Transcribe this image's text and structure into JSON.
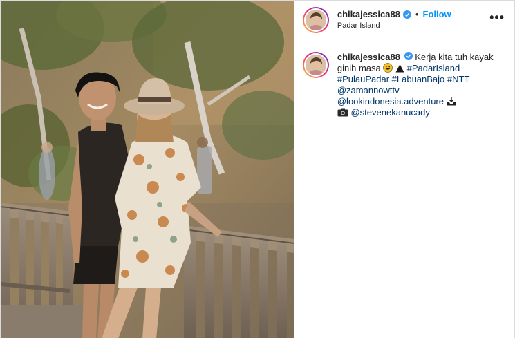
{
  "post": {
    "username": "chikajessica88",
    "verified": true,
    "follow_label": "Follow",
    "separator": "•",
    "location": "Padar Island",
    "more_label": "•••",
    "caption": {
      "username": "chikajessica88",
      "text_1": "Kerja kita tuh kayak ginih masa",
      "tags": [
        "#PadarIsland",
        "#PulauPadar",
        "#LabuanBajo",
        "#NTT"
      ],
      "mentions": [
        "@zamannowttv",
        "@lookindonesia.adventure",
        "@stevenekanucady"
      ],
      "emojis": [
        "grinning-face-icon",
        "mountain-icon",
        "inbox-tray-icon",
        "camera-icon"
      ]
    }
  },
  "colors": {
    "link": "#00376b",
    "follow": "#0095f6",
    "verified": "#3897f0"
  }
}
